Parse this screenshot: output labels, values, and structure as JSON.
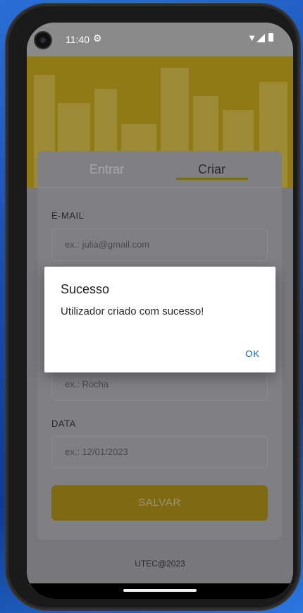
{
  "status_bar": {
    "time": "11:40",
    "icons": [
      "gear-icon",
      "wifi-icon",
      "signal-icon",
      "battery-icon"
    ]
  },
  "tabs": [
    {
      "label": "Entrar",
      "selected": false
    },
    {
      "label": "Criar",
      "selected": true
    }
  ],
  "form": {
    "email_label": "E-MAIL",
    "email_placeholder": "ex.: julia@gmail.com",
    "surname_placeholder": "ex.: Rocha",
    "date_label": "DATA",
    "date_placeholder": "ex.: 12/01/2023",
    "save_label": "SALVAR"
  },
  "footer": "UTEC@2023",
  "dialog": {
    "title": "Sucesso",
    "message": "Utilizador criado com sucesso!",
    "ok_label": "OK"
  },
  "colors": {
    "accent_yellow": "#f2c200",
    "dialog_button": "#0a6a9a",
    "scrim": "rgba(0,0,0,0.5)"
  }
}
